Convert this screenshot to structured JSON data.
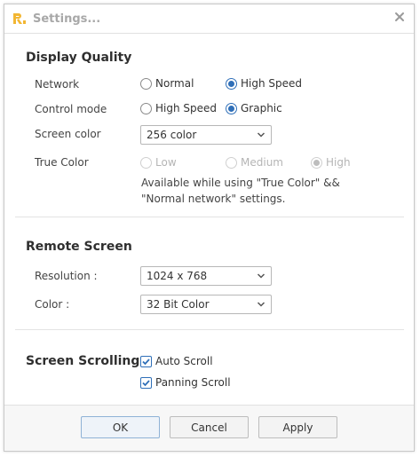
{
  "window": {
    "title": "Settings..."
  },
  "display_quality": {
    "title": "Display Quality",
    "network": {
      "label": "Network",
      "options": [
        "Normal",
        "High Speed"
      ],
      "selected": "High Speed"
    },
    "control_mode": {
      "label": "Control mode",
      "options": [
        "High Speed",
        "Graphic"
      ],
      "selected": "Graphic"
    },
    "screen_color": {
      "label": "Screen color",
      "value": "256 color"
    },
    "true_color": {
      "label": "True Color",
      "options": [
        "Low",
        "Medium",
        "High"
      ],
      "selected": "High",
      "note": "Available while using \"True Color\" && \"Normal network\" settings."
    }
  },
  "remote_screen": {
    "title": "Remote Screen",
    "resolution": {
      "label": "Resolution :",
      "value": "1024 x 768"
    },
    "color": {
      "label": "Color :",
      "value": "32 Bit Color"
    }
  },
  "screen_scrolling": {
    "title": "Screen Scrolling",
    "auto_scroll": {
      "label": "Auto Scroll",
      "checked": true
    },
    "panning_scroll": {
      "label": "Panning Scroll",
      "checked": true
    }
  },
  "footer": {
    "ok": "OK",
    "cancel": "Cancel",
    "apply": "Apply"
  },
  "colors": {
    "accent": "#2f6fb8",
    "logo": "#f2b632"
  }
}
